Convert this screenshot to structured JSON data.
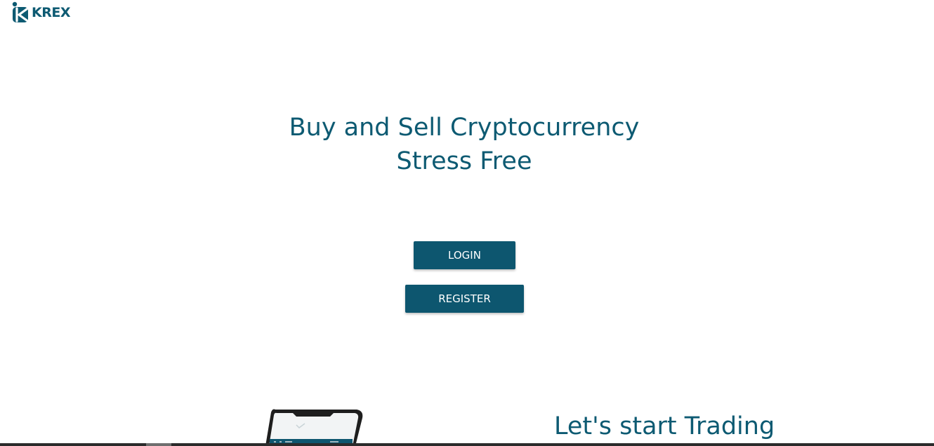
{
  "brand": {
    "logo_text": "KREX",
    "color": "#0d5a72"
  },
  "hero": {
    "title_line1": "Buy and Sell Cryptocurrency",
    "title_line2": "Stress Free"
  },
  "actions": {
    "login_label": "LOGIN",
    "register_label": "REGISTER",
    "button_color": "#0d566f"
  },
  "trading_section": {
    "title": "Let's start Trading"
  },
  "icons": {
    "logo": "krex-logo-icon",
    "phone": "phone-mockup-image"
  }
}
